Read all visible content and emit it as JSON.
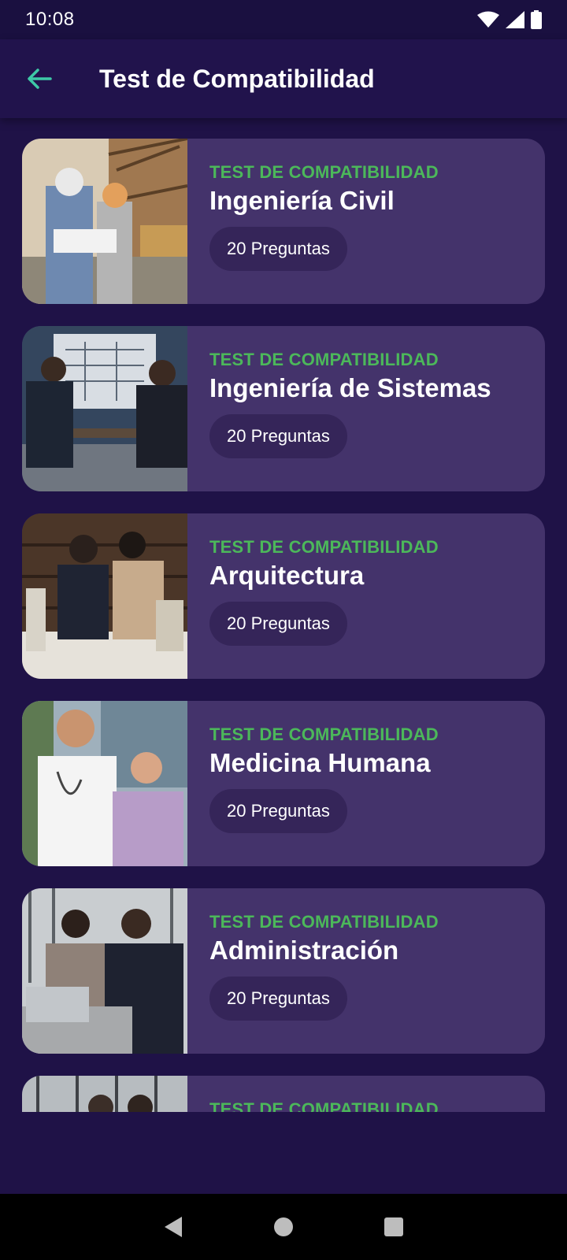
{
  "status_bar": {
    "time": "10:08"
  },
  "app_bar": {
    "title": "Test de Compatibilidad"
  },
  "cards": [
    {
      "kicker": "TEST DE COMPATIBILIDAD",
      "title": "Ingeniería Civil",
      "questions": "20 Preguntas"
    },
    {
      "kicker": "TEST DE COMPATIBILIDAD",
      "title": "Ingeniería de Sistemas",
      "questions": "20 Preguntas"
    },
    {
      "kicker": "TEST DE COMPATIBILIDAD",
      "title": "Arquitectura",
      "questions": "20 Preguntas"
    },
    {
      "kicker": "TEST DE COMPATIBILIDAD",
      "title": "Medicina Humana",
      "questions": "20 Preguntas"
    },
    {
      "kicker": "TEST DE COMPATIBILIDAD",
      "title": "Administración",
      "questions": "20 Preguntas"
    },
    {
      "kicker": "TEST DE COMPATIBILIDAD",
      "title": "",
      "questions": ""
    }
  ],
  "colors": {
    "background": "#1f1247",
    "app_bar": "#21134c",
    "card": "#44336b",
    "pill": "#352559",
    "accent_green": "#4cb85a",
    "back_arrow": "#3ec9a7"
  },
  "icons": {
    "back": "arrow-left-icon",
    "wifi": "wifi-icon",
    "signal": "signal-icon",
    "battery": "battery-icon",
    "nav_back": "triangle-back-icon",
    "nav_home": "circle-home-icon",
    "nav_recents": "square-recents-icon"
  }
}
